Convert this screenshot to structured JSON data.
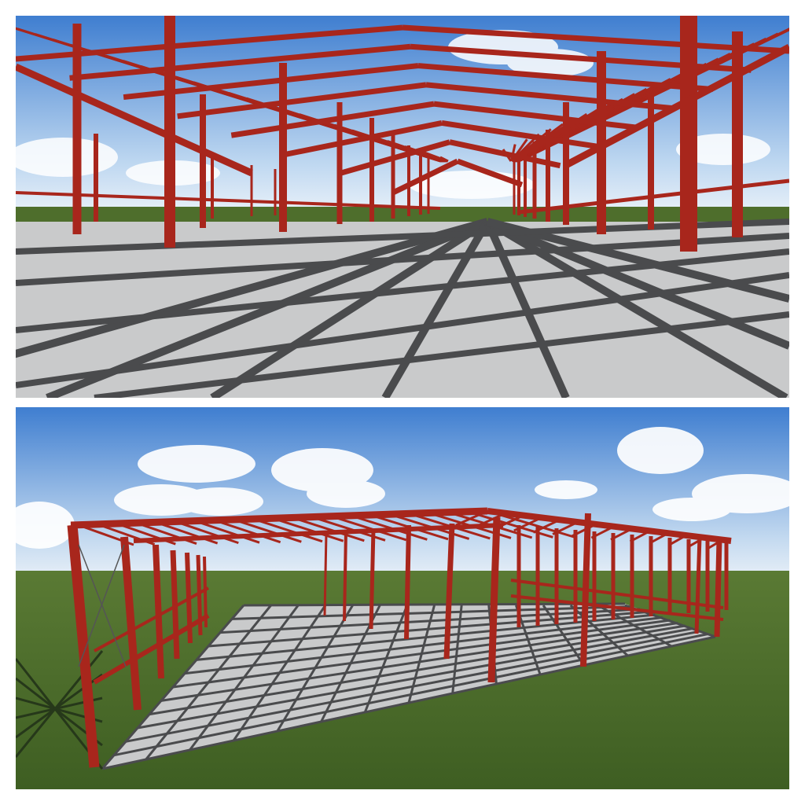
{
  "collage": {
    "panel_count": 2,
    "panels": [
      {
        "view": "interior-perspective",
        "subject": "steel-frame-building"
      },
      {
        "view": "exterior-perspective",
        "subject": "steel-frame-building"
      }
    ]
  },
  "colors": {
    "steel": "#a8261c",
    "steel_dark": "#6e1510",
    "sky_top": "#3f7ed0",
    "sky_bottom": "#d7e6f4",
    "slab": "#c9cacb",
    "shadow": "#4a4b4d",
    "grass": "#4e6e2c"
  }
}
